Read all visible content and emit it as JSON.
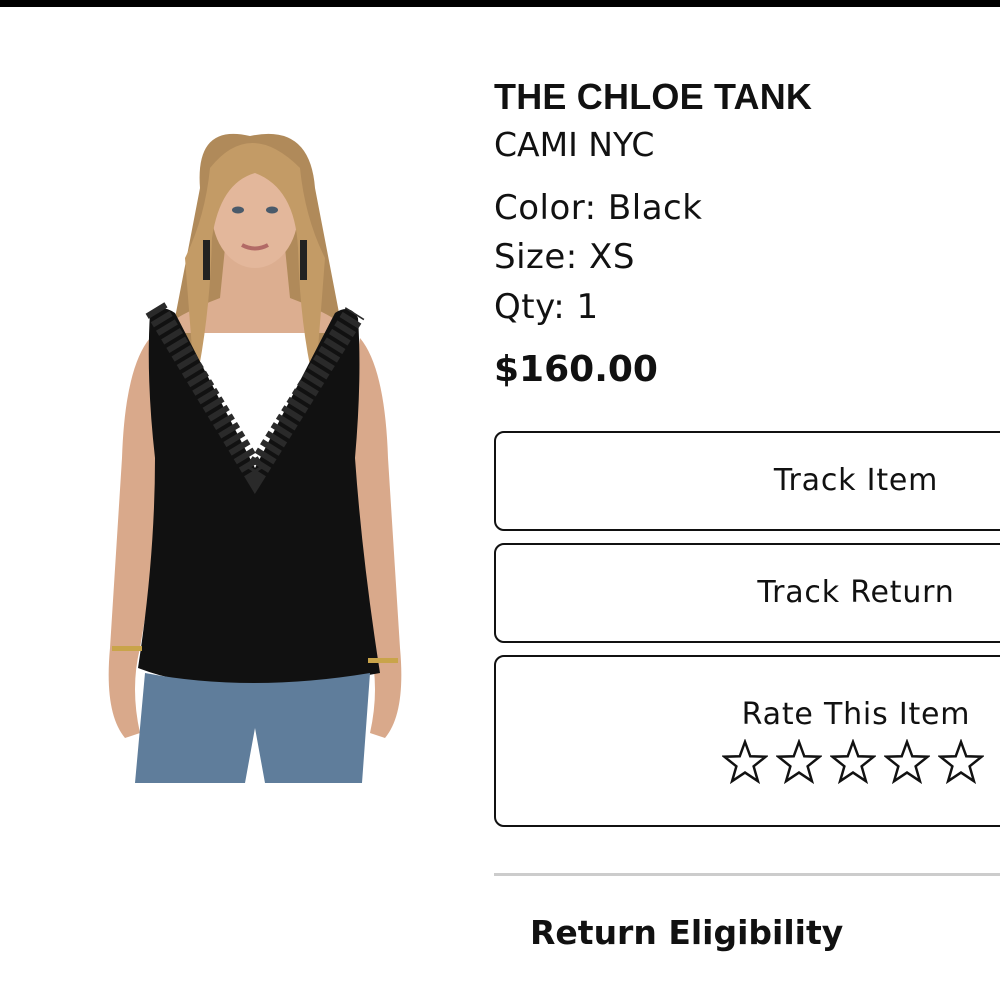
{
  "product": {
    "name": "THE CHLOE TANK",
    "brand": "CAMI NYC",
    "color": "Color: Black",
    "size": "Size: XS",
    "qty": "Qty: 1",
    "price": "$160.00",
    "image_alt": "Model wearing black lace-trim tank"
  },
  "actions": {
    "track_item": "Track Item",
    "track_return": "Track Return",
    "rate_item": "Rate This Item",
    "rating_max": 5,
    "rating_value": 0
  },
  "returns": {
    "section_title": "Return Eligibility"
  },
  "colors": {
    "text": "#111111",
    "border": "#111111",
    "divider": "#cccccc",
    "top_bar": "#000000"
  }
}
